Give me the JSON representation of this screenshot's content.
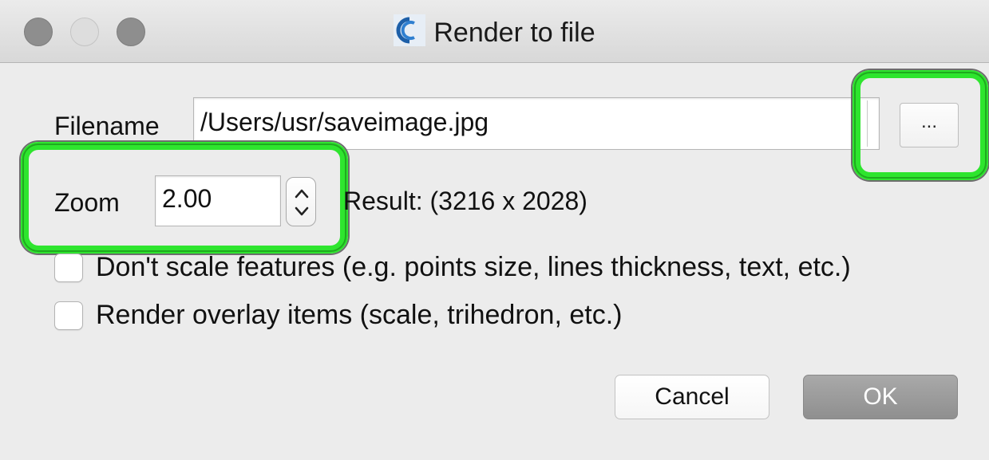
{
  "window": {
    "title": "Render to file",
    "app_icon": "cloudcompare-logo-icon"
  },
  "form": {
    "filename_label": "Filename",
    "filename_value": "/Users/usr/saveimage.jpg",
    "browse_label": "...",
    "zoom_label": "Zoom",
    "zoom_value": "2.00",
    "result_text": "Result:  (3216 x 2028)"
  },
  "options": [
    {
      "label": "Don't scale features (e.g. points size, lines thickness, text, etc.)",
      "checked": false
    },
    {
      "label": "Render overlay items (scale, trihedron, etc.)",
      "checked": false
    }
  ],
  "buttons": {
    "cancel": "Cancel",
    "ok": "OK"
  },
  "colors": {
    "highlight": "#2ee52e",
    "ok_button": "#9b9b9b",
    "background": "#ececec"
  }
}
